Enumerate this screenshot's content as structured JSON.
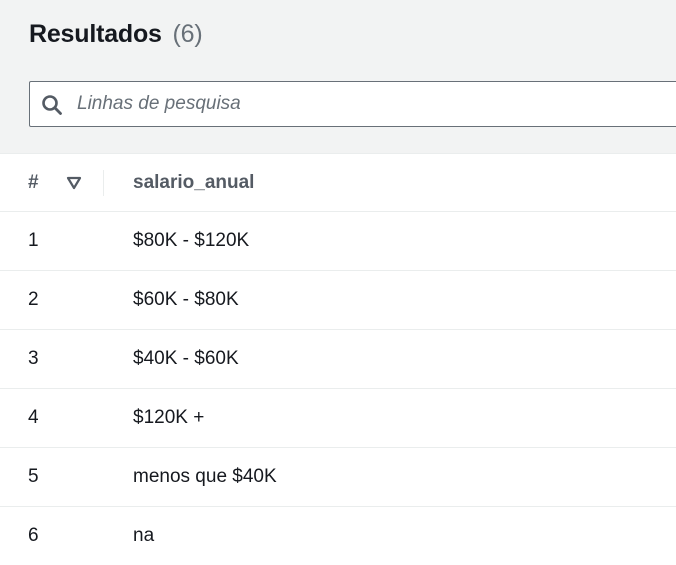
{
  "results": {
    "title": "Resultados",
    "count": "(6)"
  },
  "search": {
    "placeholder": "Linhas de pesquisa",
    "value": "",
    "icon": "search-icon"
  },
  "table": {
    "columns": [
      "#",
      "salario_anual"
    ],
    "sort_icon": "sort-descending-icon",
    "rows": [
      {
        "num": "1",
        "salario_anual": "$80K - $120K"
      },
      {
        "num": "2",
        "salario_anual": "$60K - $80K"
      },
      {
        "num": "3",
        "salario_anual": "$40K - $60K"
      },
      {
        "num": "4",
        "salario_anual": "$120K +"
      },
      {
        "num": "5",
        "salario_anual": "menos que $40K"
      },
      {
        "num": "6",
        "salario_anual": "na"
      }
    ]
  },
  "colors": {
    "header_bg": "#f2f3f3",
    "text": "#16191f",
    "muted": "#687078",
    "border": "#eaeded"
  }
}
